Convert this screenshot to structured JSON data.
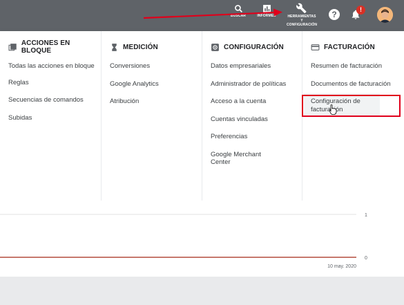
{
  "topbar": {
    "search_label": "BUSCAR",
    "reports_label": "INFORMES",
    "tools_label": "HERRAMIENTAS\nY\nCONFIGURACIÓN",
    "help_glyph": "?",
    "notif_badge": "!"
  },
  "menu": {
    "columns": [
      {
        "title": "ACCIONES EN BLOQUE",
        "icon": "bulk-actions-icon",
        "items": [
          "Todas las acciones en bloque",
          "Reglas",
          "Secuencias de comandos",
          "Subidas"
        ]
      },
      {
        "title": "MEDICIÓN",
        "icon": "hourglass-icon",
        "items": [
          "Conversiones",
          "Google Analytics",
          "Atribución"
        ]
      },
      {
        "title": "CONFIGURACIÓN",
        "icon": "settings-icon",
        "items": [
          "Datos empresariales",
          "Administrador de políticas",
          "Acceso a la cuenta",
          "Cuentas vinculadas",
          "Preferencias",
          "Google Merchant Center"
        ]
      },
      {
        "title": "FACTURACIÓN",
        "icon": "credit-card-icon",
        "items": [
          "Resumen de facturación",
          "Documentos de facturación",
          "Configuración de facturación"
        ]
      }
    ]
  },
  "chart_data": {
    "type": "line",
    "x": [
      "10 may. 2020"
    ],
    "series": [
      {
        "values": [
          0
        ]
      }
    ],
    "y_ticks": [
      "1",
      "0"
    ],
    "ylim": [
      0,
      1
    ],
    "xlabel": "",
    "ylabel": "",
    "line_color": "#a52714"
  },
  "colors": {
    "topbar": "#5f6368",
    "annotation": "#e0001b",
    "badge": "#d93025"
  }
}
